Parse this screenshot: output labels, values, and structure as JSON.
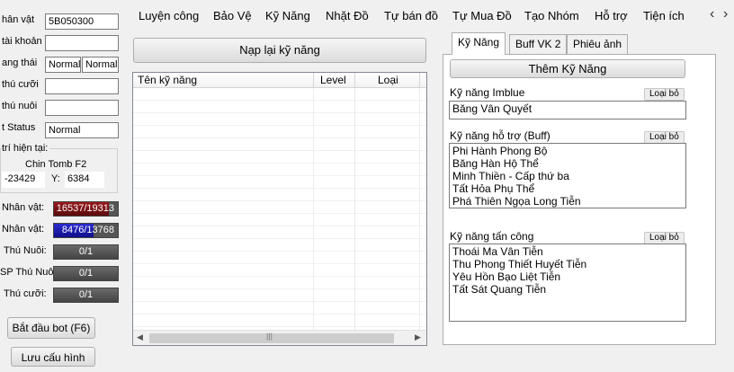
{
  "left": {
    "name_label": "hân vật",
    "name_value": "5B050300",
    "account_label": "tài khoản",
    "account_value": "",
    "status_label": "ang thái",
    "status_value1": "Normal",
    "status_value2": "Normal",
    "mount_label": "thú cưỡi",
    "mount_value": "",
    "pet_label": "thú nuôi",
    "pet_value": "",
    "petstatus_label": "t Status",
    "petstatus_value": "Normal",
    "position_title": "trí hiện tại:",
    "map_name": "Chin Tomb F2",
    "x_value": "-23429",
    "y_label": "Y:",
    "y_value": "6384",
    "hp_char_label": "Nhân vật:",
    "hp_char_value": "16537/19313",
    "hp_char_fill": 0.856,
    "mp_char_label": "Nhân vật:",
    "mp_char_value": "8476/13768",
    "mp_char_fill": 0.616,
    "hp_pet_label": "Thú Nuôi:",
    "hp_pet_value": "0/1",
    "mp_pet_label": "SP Thú Nuôi:",
    "mp_pet_value": "0/1",
    "hp_mount_label": "Thú cưỡi:",
    "hp_mount_value": "0/1",
    "start_button": "Bắt đầu bot (F6)",
    "save_button": "Lưu cấu hình"
  },
  "menu": [
    "Luyện công",
    "Bảo Vệ",
    "Kỹ Năng",
    "Nhặt Đồ",
    "Tự bán đồ",
    "Tự Mua Đồ",
    "Tạo Nhóm",
    "Hỗ trợ",
    "Tiện ích"
  ],
  "nav": {
    "prev": "‹",
    "next": "›"
  },
  "skills_panel": {
    "reload_button": "Nạp lại kỹ năng",
    "columns": [
      "Tên kỹ năng",
      "Level",
      "Loại"
    ]
  },
  "tabs": [
    "Kỹ Năng",
    "Buff VK 2",
    "Phiêu ảnh"
  ],
  "right": {
    "add_skill_button": "Thêm Kỹ Năng",
    "imblue_title": "Kỹ năng Imblue",
    "imblue_remove": "Loại bỏ",
    "imblue_value": "Băng Vân Quyết",
    "buff_title": "Kỹ năng hỗ trợ (Buff)",
    "buff_remove": "Loại bỏ",
    "buff_items": [
      "Phi Hành Phong Bộ",
      "Băng Hàn Hộ Thể",
      "Minh Thiền - Cấp thứ ba",
      "Tất Hỏa Phụ Thể",
      "Phá Thiên Ngọa Long Tiễn"
    ],
    "attack_title": "Kỹ năng tấn công",
    "attack_remove": "Loại bỏ",
    "attack_items": [
      "Thoái Ma Vân Tiễn",
      "Thu Phong Thiết Huyết Tiễn",
      "Yêu Hồn Bạo Liệt Tiễn",
      "Tất Sát Quang Tiễn"
    ]
  },
  "colors": {
    "hp": "#7a0e12",
    "mp": "#1f1fb0",
    "empty_bar": "#555555"
  }
}
